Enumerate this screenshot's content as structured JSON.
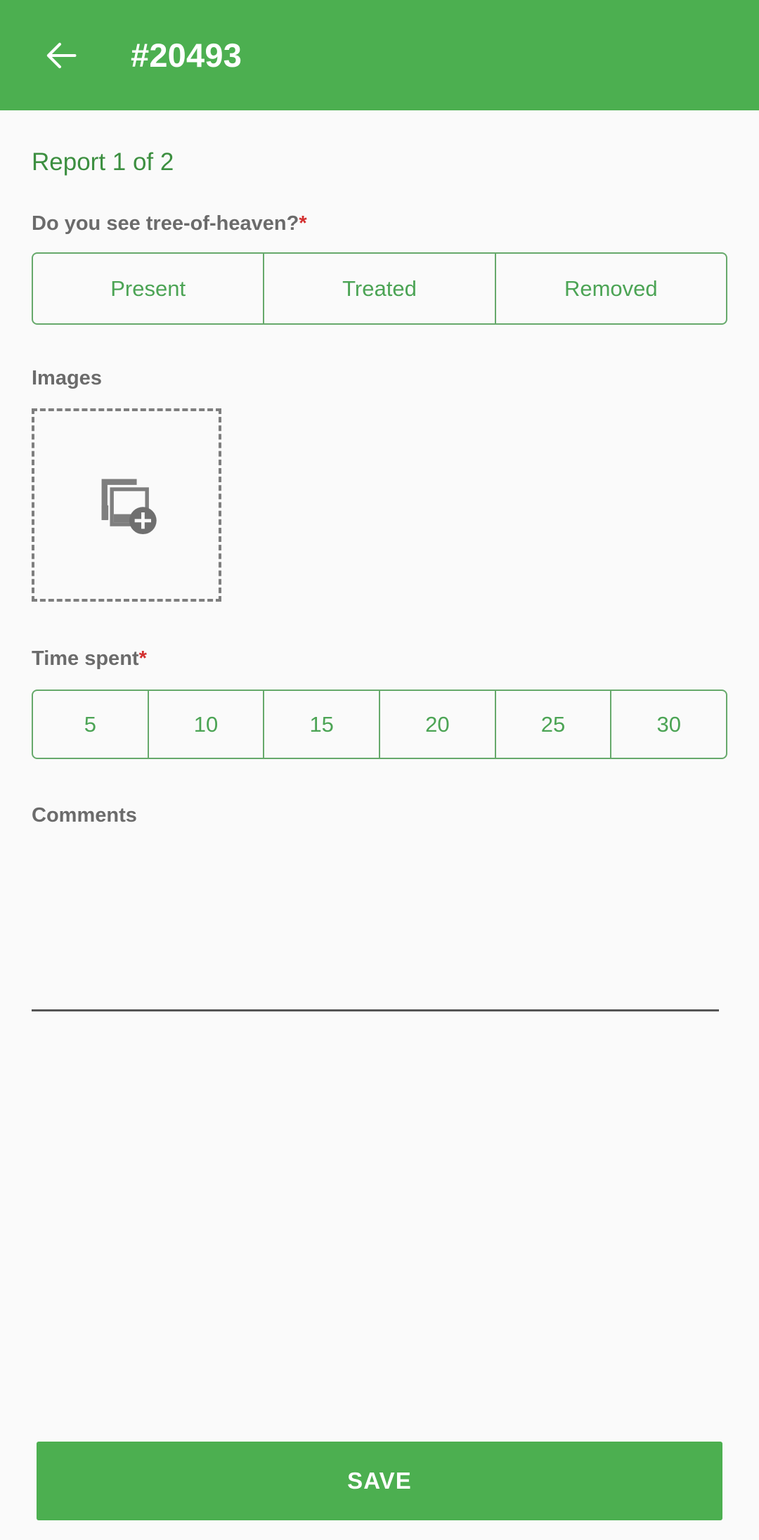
{
  "appbar": {
    "back_icon": "arrow-back-icon",
    "title": "#20493",
    "background_color": "#4caf50",
    "title_color": "#ffffff"
  },
  "colors": {
    "page_background": "#fafafa",
    "accent_green": "#4caf50",
    "outline_green": "#66a96b",
    "text_green": "#4ca455",
    "report_counter_green": "#3c8f40",
    "label_gray": "#6b6b6b",
    "required_red": "#d32f2f",
    "dashed_gray": "#7e7e7e",
    "underline_gray": "#555555"
  },
  "form": {
    "report_counter": "Report 1 of 2",
    "question": {
      "label": "Do you see tree-of-heaven?",
      "required_marker": "*",
      "options": [
        {
          "label": "Present",
          "selected": false
        },
        {
          "label": "Treated",
          "selected": false
        },
        {
          "label": "Removed",
          "selected": false
        }
      ]
    },
    "images": {
      "label": "Images",
      "required_marker": "",
      "add_icon": "add-to-photos-icon",
      "items": []
    },
    "time_spent": {
      "label": "Time spent",
      "required_marker": "*",
      "options": [
        {
          "label": "5",
          "selected": false
        },
        {
          "label": "10",
          "selected": false
        },
        {
          "label": "15",
          "selected": false
        },
        {
          "label": "20",
          "selected": false
        },
        {
          "label": "25",
          "selected": false
        },
        {
          "label": "30",
          "selected": false
        }
      ]
    },
    "comments": {
      "label": "Comments",
      "required_marker": "",
      "value": "",
      "placeholder": ""
    }
  },
  "footer": {
    "save_label": "SAVE"
  }
}
